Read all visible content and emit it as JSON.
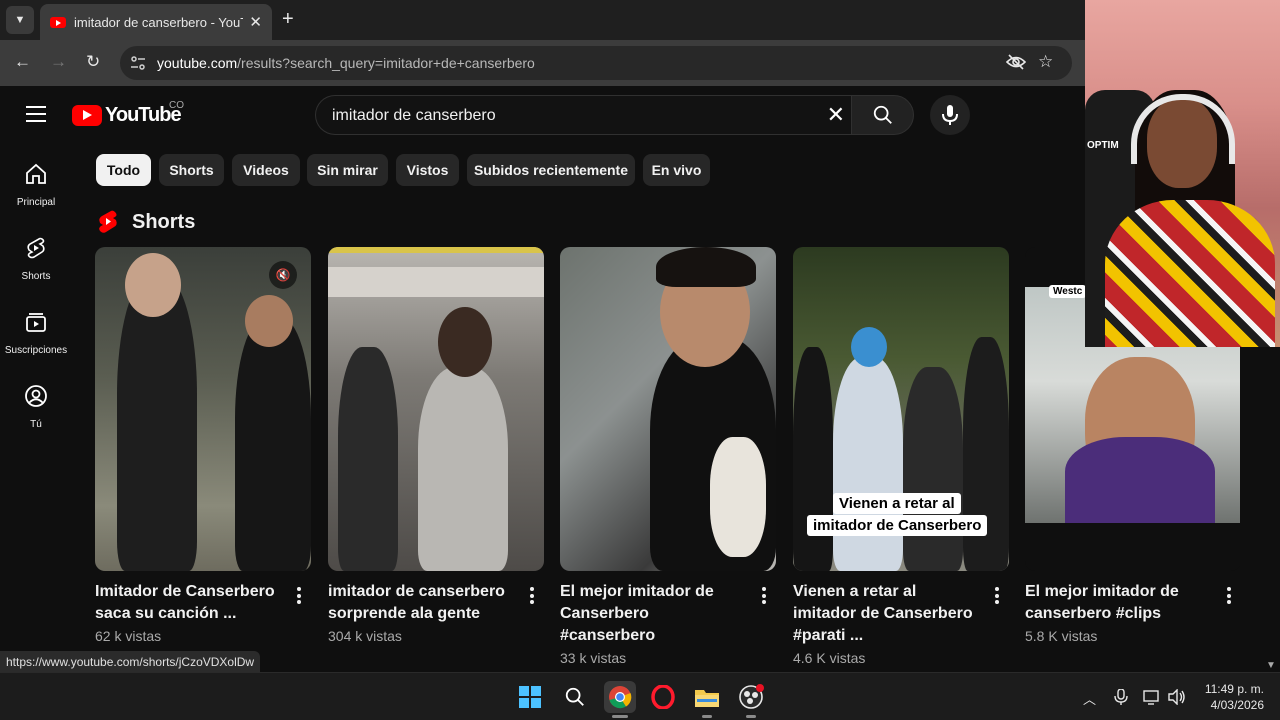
{
  "browser": {
    "tab_title": "imitador de canserbero - YouTube",
    "url_host": "youtube.com",
    "url_rest": "/results?search_query=imitador+de+canserbero",
    "status_url": "https://www.youtube.com/shorts/jCzoVDXolDw"
  },
  "youtube": {
    "logo_text": "YouTube",
    "country_code": "CO",
    "search_query": "imitador de canserbero"
  },
  "sidebar": {
    "items": [
      {
        "label": "Principal",
        "icon": "home-icon"
      },
      {
        "label": "Shorts",
        "icon": "shorts-icon"
      },
      {
        "label": "Suscripciones",
        "icon": "subscriptions-icon"
      },
      {
        "label": "Tú",
        "icon": "you-icon"
      }
    ]
  },
  "chips": [
    "Todo",
    "Shorts",
    "Videos",
    "Sin mirar",
    "Vistos",
    "Subidos recientemente",
    "En vivo"
  ],
  "active_chip": "Todo",
  "shorts_section": {
    "title": "Shorts",
    "items": [
      {
        "title": "Imitador de Canserbero saca su canción ...",
        "views": "62 k vistas"
      },
      {
        "title": "imitador de canserbero sorprende ala gente",
        "views": "304 k vistas"
      },
      {
        "title": "El mejor imitador de Canserbero #canserbero",
        "views": "33 k vistas"
      },
      {
        "title": "Vienen a retar al imitador de Canserbero #parati ...",
        "views": "4.6 K vistas",
        "overlay_line1": "Vienen a retar al",
        "overlay_line2": "imitador de Canserbero"
      },
      {
        "title": "El mejor imitador de canserbero #clips",
        "views": "5.8 K vistas",
        "overlay_text": "Westc"
      }
    ]
  },
  "webcam": {
    "brand_text": "OPTIM"
  },
  "taskbar": {
    "time": "11:49 p. m.",
    "date": "4/03/2026"
  },
  "colors": {
    "youtube_red": "#ff0000",
    "background": "#0f0f0f",
    "chip_bg": "#272727"
  }
}
